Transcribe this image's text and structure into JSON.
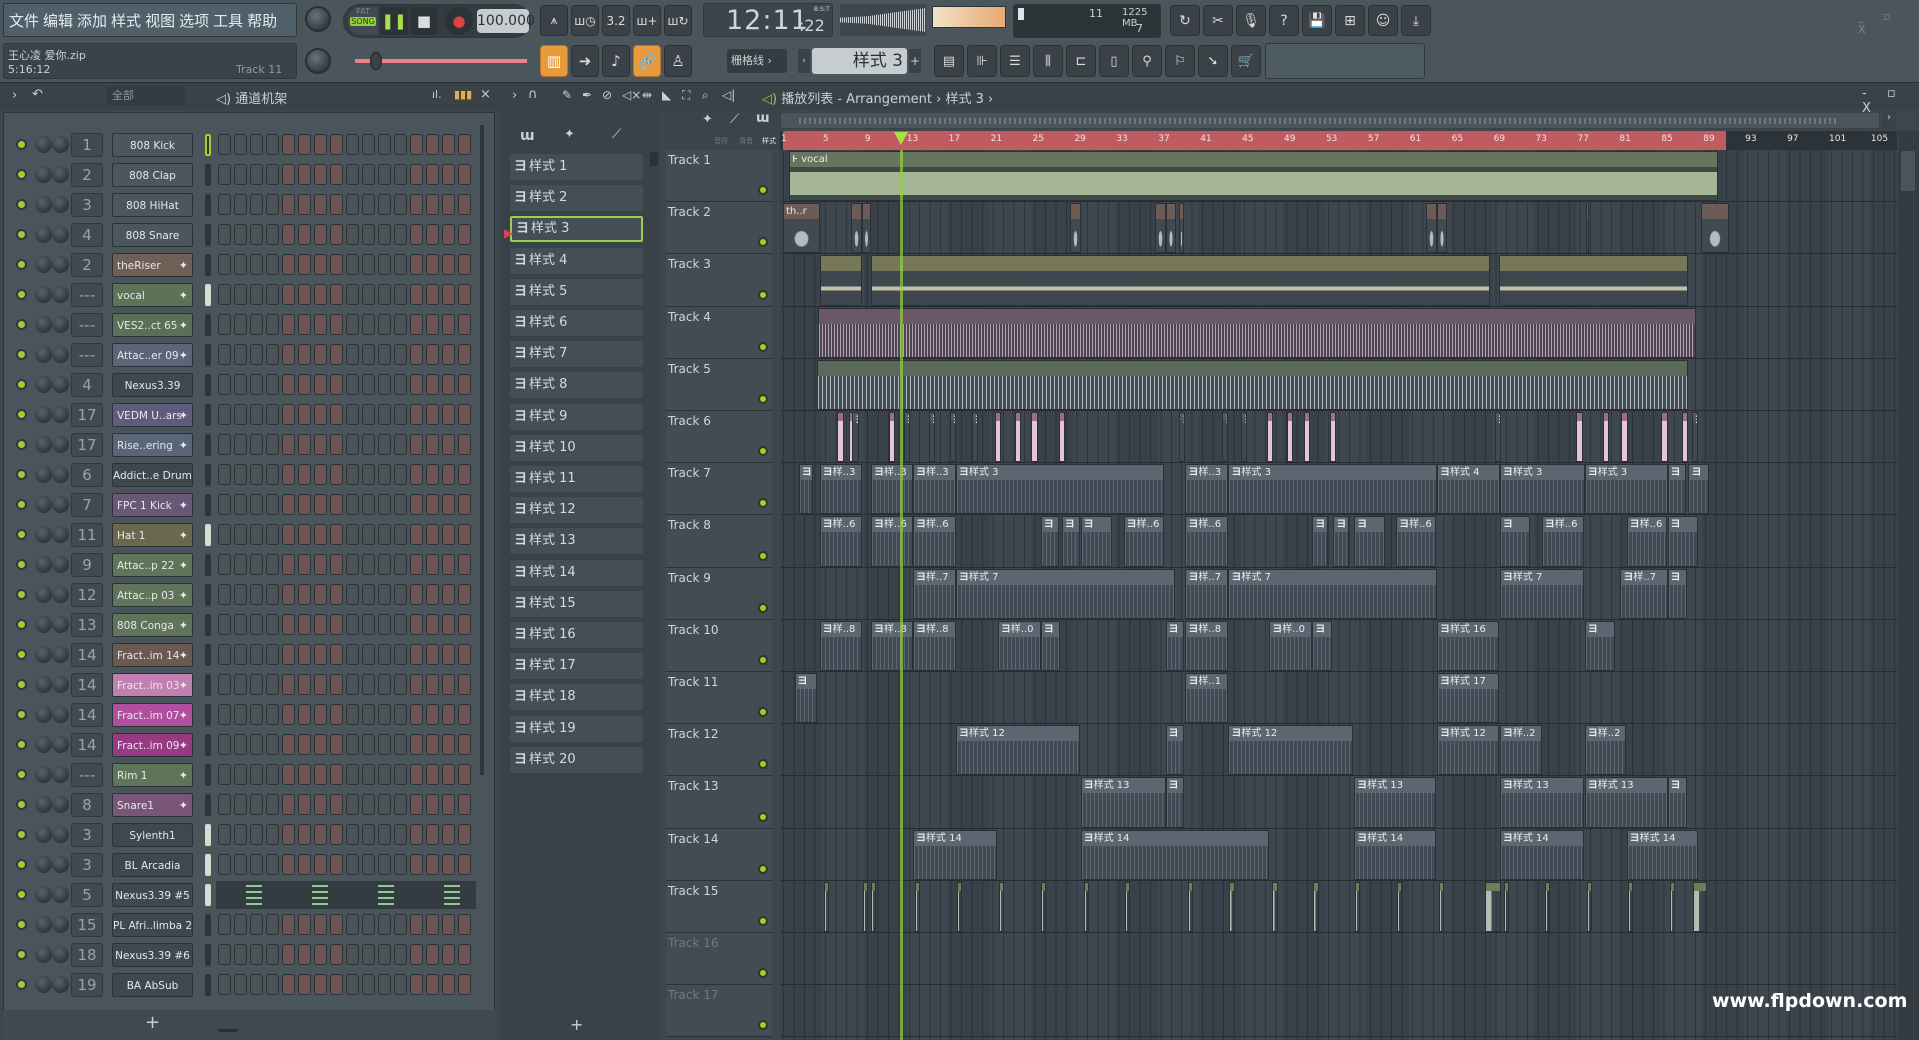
{
  "menu": [
    "文件",
    "编辑",
    "添加",
    "样式",
    "视图",
    "选项",
    "工具",
    "帮助"
  ],
  "transport": {
    "pat": "PAT",
    "song": "SONG",
    "tempo": "100.000",
    "time": "12:11",
    "time_small": ":22",
    "time_unit": "B:S:T"
  },
  "monitor": {
    "cpu": "11",
    "mem": "1225 MB",
    "poly": "7"
  },
  "hint": {
    "file": "王心凌 爱你.zip",
    "time": "5:16:12",
    "track": "Track 11"
  },
  "toolbar2": {
    "snap": "栅格线",
    "pattern": "样式 3",
    "add": "+"
  },
  "channel_rack": {
    "filter": "全部",
    "title": "通道机架",
    "add": "+",
    "channels": [
      {
        "num": "1",
        "name": "808 Kick",
        "color": "#4c565d",
        "sel": true
      },
      {
        "num": "2",
        "name": "808 Clap",
        "color": "#4c565d"
      },
      {
        "num": "3",
        "name": "808 HiHat",
        "color": "#4c565d"
      },
      {
        "num": "4",
        "name": "808 Snare",
        "color": "#4c565d"
      },
      {
        "num": "2",
        "name": "theRiser",
        "color": "#6f5f56",
        "wave": true
      },
      {
        "num": "---",
        "name": "vocal",
        "color": "#5e7258",
        "wave": true,
        "lit": true
      },
      {
        "num": "---",
        "name": "VES2..ct 65",
        "color": "#5a7057",
        "wave": true
      },
      {
        "num": "---",
        "name": "Attac..er 09",
        "color": "#5d6479",
        "wave": true
      },
      {
        "num": "4",
        "name": "Nexus3.39",
        "color": "#3f484f"
      },
      {
        "num": "17",
        "name": "VEDM U..ars",
        "color": "#615b7b",
        "wave": true
      },
      {
        "num": "17",
        "name": "Rise..ering",
        "color": "#5a6678",
        "wave": true
      },
      {
        "num": "6",
        "name": "Addict..e Drums",
        "color": "#3e474e"
      },
      {
        "num": "7",
        "name": "FPC 1 Kick",
        "color": "#6a5677",
        "wave": true
      },
      {
        "num": "11",
        "name": "Hat 1",
        "color": "#6b694d",
        "wave": true,
        "lit": true
      },
      {
        "num": "9",
        "name": "Attac..p 22",
        "color": "#5f7459",
        "wave": true
      },
      {
        "num": "12",
        "name": "Attac..p 03",
        "color": "#5f7459",
        "wave": true
      },
      {
        "num": "13",
        "name": "808 Conga",
        "color": "#5f7459",
        "wave": true
      },
      {
        "num": "14",
        "name": "Fract..im 14",
        "color": "#6b5a52",
        "wave": true
      },
      {
        "num": "14",
        "name": "Fract..im 03",
        "color": "#c27fb2",
        "wave": true
      },
      {
        "num": "14",
        "name": "Fract..im 07",
        "color": "#b04f9f",
        "wave": true
      },
      {
        "num": "14",
        "name": "Fract..im 09",
        "color": "#963a83",
        "wave": true
      },
      {
        "num": "---",
        "name": "Rim 1",
        "color": "#5e7559",
        "wave": true
      },
      {
        "num": "8",
        "name": "Snare1",
        "color": "#7a5577",
        "wave": true
      },
      {
        "num": "3",
        "name": "Sylenth1",
        "color": "#3f484f",
        "lit": true
      },
      {
        "num": "3",
        "name": "BL Arcadia",
        "color": "#3f484f",
        "lit": true
      },
      {
        "num": "5",
        "name": "Nexus3.39 #5",
        "color": "#3f484f",
        "lit": true,
        "roll": true
      },
      {
        "num": "15",
        "name": "PL Afri..limba 2",
        "color": "#3f484f"
      },
      {
        "num": "18",
        "name": "Nexus3.39 #6",
        "color": "#3f484f"
      },
      {
        "num": "19",
        "name": "BA AbSub",
        "color": "#3f484f"
      }
    ]
  },
  "playlist": {
    "title": "播放列表 - Arrangement",
    "crumb": "样式 3",
    "add": "+",
    "col_labels": [
      "音符",
      "滑音",
      "样式"
    ],
    "patterns": [
      "样式 1",
      "样式 2",
      "样式 3",
      "样式 4",
      "样式 5",
      "样式 6",
      "样式 7",
      "样式 8",
      "样式 9",
      "样式 10",
      "样式 11",
      "样式 12",
      "样式 13",
      "样式 14",
      "样式 15",
      "样式 16",
      "样式 17",
      "样式 18",
      "样式 19",
      "样式 20"
    ],
    "selected_pattern": "样式 3",
    "ruler": [
      "1",
      "5",
      "9",
      "13",
      "17",
      "21",
      "25",
      "29",
      "33",
      "37",
      "41",
      "45",
      "49",
      "53",
      "57",
      "61",
      "65",
      "69",
      "73",
      "77",
      "81",
      "85",
      "89",
      "93",
      "97",
      "101",
      "105"
    ],
    "playhead_bar": 12.2,
    "song_end_bar": 91,
    "tracks": [
      {
        "name": "Track 1",
        "type": "audio",
        "clips": [
          [
            1.6,
            90.2,
            "vocal"
          ]
        ]
      },
      {
        "name": "Track 2",
        "type": "riser",
        "clips": [
          [
            1,
            4.5,
            "th..r"
          ],
          [
            7.5,
            8.5,
            ""
          ],
          [
            8.5,
            9.4,
            ""
          ],
          [
            28.4,
            29.4,
            ""
          ],
          [
            36.5,
            37.5,
            ""
          ],
          [
            37.5,
            38.5,
            ""
          ],
          [
            38.8,
            39.3,
            ""
          ],
          [
            62.4,
            63.4,
            ""
          ],
          [
            63.4,
            64.4,
            ""
          ],
          [
            77.6,
            77.9,
            ""
          ],
          [
            88.6,
            91.3,
            ""
          ]
        ]
      },
      {
        "name": "Track 3",
        "type": "olive",
        "clips": [
          [
            4.5,
            8.5,
            ""
          ],
          [
            9.4,
            68.5,
            ""
          ],
          [
            69.3,
            87.4,
            ""
          ]
        ]
      },
      {
        "name": "Track 4",
        "type": "pink",
        "clips": [
          [
            4.3,
            88.1,
            ""
          ]
        ]
      },
      {
        "name": "Track 5",
        "type": "gray",
        "clips": [
          [
            4.2,
            87.4,
            ""
          ]
        ]
      },
      {
        "name": "Track 6",
        "type": "pinkbits",
        "clips": [
          [
            6.2,
            6.8,
            ""
          ],
          [
            7.3,
            7.9,
            ""
          ],
          [
            7.6,
            8.3,
            "ヨ"
          ],
          [
            11.1,
            11.7,
            ""
          ],
          [
            12.5,
            13.1,
            "ヨ"
          ],
          [
            14.9,
            15.5,
            "ヨ"
          ],
          [
            16.9,
            17.5,
            "ヨ"
          ],
          [
            19,
            19.6,
            "ヨ"
          ],
          [
            21.2,
            21.8,
            ""
          ],
          [
            23.1,
            23.7,
            ""
          ],
          [
            24.7,
            25.3,
            ""
          ],
          [
            27.3,
            27.9,
            ""
          ],
          [
            38.8,
            39.4,
            "ヨ"
          ],
          [
            42.9,
            43.5,
            "ヨ"
          ],
          [
            44.7,
            45.3,
            "ヨ"
          ],
          [
            47.2,
            47.8,
            ""
          ],
          [
            49.1,
            49.7,
            ""
          ],
          [
            50.7,
            51.3,
            ""
          ],
          [
            53.2,
            53.8,
            ""
          ],
          [
            68.9,
            69.5,
            "ヨ"
          ],
          [
            76.7,
            77.3,
            ""
          ],
          [
            79.2,
            79.8,
            ""
          ],
          [
            81,
            81.6,
            ""
          ],
          [
            84.8,
            85.4,
            ""
          ],
          [
            86.8,
            87.4,
            ""
          ],
          [
            87.7,
            88.3,
            "ヨ"
          ]
        ]
      },
      {
        "name": "Track 7",
        "type": "pattern",
        "clips": [
          [
            2.5,
            3.9,
            ""
          ],
          [
            4.5,
            8.5,
            "样..3"
          ],
          [
            9.4,
            13.4,
            "样..3"
          ],
          [
            13.4,
            17.5,
            "样..3"
          ],
          [
            17.5,
            37.4,
            "样式 3"
          ],
          [
            39.4,
            43.5,
            "样..3"
          ],
          [
            43.5,
            63.4,
            "样式 3"
          ],
          [
            63.4,
            69.4,
            "样式 4"
          ],
          [
            69.4,
            77.5,
            "样式 3"
          ],
          [
            77.5,
            85.4,
            "样式 3"
          ],
          [
            85.4,
            87.2,
            ""
          ],
          [
            87.4,
            89.4,
            ""
          ]
        ]
      },
      {
        "name": "Track 8",
        "type": "pattern",
        "clips": [
          [
            4.5,
            8.5,
            "样..6"
          ],
          [
            9.4,
            13.4,
            "样..6"
          ],
          [
            13.4,
            17.5,
            "样..6"
          ],
          [
            25.6,
            27.3,
            ""
          ],
          [
            27.6,
            29.3,
            ""
          ],
          [
            29.4,
            32.4,
            ""
          ],
          [
            33.5,
            37.4,
            "样..6"
          ],
          [
            39.4,
            43.5,
            "样..6"
          ],
          [
            51.5,
            53,
            ""
          ],
          [
            53.5,
            55,
            ""
          ],
          [
            55.5,
            58.4,
            ""
          ],
          [
            59.5,
            63.3,
            "样..6"
          ],
          [
            69.4,
            72.3,
            ""
          ],
          [
            73.4,
            77.4,
            "样..6"
          ],
          [
            81.5,
            85.4,
            "样..6"
          ],
          [
            85.4,
            88.3,
            ""
          ]
        ]
      },
      {
        "name": "Track 9",
        "type": "pattern",
        "clips": [
          [
            13.4,
            17.5,
            "样..7"
          ],
          [
            17.5,
            38.4,
            "样式 7"
          ],
          [
            39.4,
            43.5,
            "样..7"
          ],
          [
            43.5,
            63.4,
            "样式 7"
          ],
          [
            69.4,
            77.4,
            "样式 7"
          ],
          [
            80.9,
            85.4,
            "样..7"
          ],
          [
            85.4,
            87.3,
            ""
          ]
        ]
      },
      {
        "name": "Track 10",
        "type": "pattern",
        "clips": [
          [
            4.5,
            8.5,
            "样..8"
          ],
          [
            9.4,
            13.4,
            "样..8"
          ],
          [
            13.4,
            17.5,
            "样..8"
          ],
          [
            21.5,
            25.6,
            "样..0"
          ],
          [
            25.6,
            27.4,
            ""
          ],
          [
            37.5,
            39.3,
            ""
          ],
          [
            39.4,
            43.5,
            "样..8"
          ],
          [
            47.4,
            51.5,
            "样..0"
          ],
          [
            51.5,
            53.4,
            ""
          ],
          [
            63.4,
            69.3,
            "样式 16"
          ],
          [
            77.5,
            80.4,
            ""
          ]
        ]
      },
      {
        "name": "Track 11",
        "type": "pattern",
        "clips": [
          [
            2.1,
            4.2,
            ""
          ],
          [
            39.4,
            43.5,
            "样..1"
          ],
          [
            63.4,
            69.3,
            "样式 17"
          ]
        ]
      },
      {
        "name": "Track 12",
        "type": "pattern",
        "clips": [
          [
            17.5,
            29.3,
            "样式 12"
          ],
          [
            37.5,
            39.3,
            ""
          ],
          [
            43.5,
            55.4,
            "样式 12"
          ],
          [
            63.4,
            69.3,
            "样式 12"
          ],
          [
            69.4,
            73.4,
            "样..2"
          ],
          [
            77.5,
            81.4,
            "样..2"
          ]
        ]
      },
      {
        "name": "Track 13",
        "type": "pattern",
        "clips": [
          [
            29.4,
            37.5,
            "样式 13"
          ],
          [
            37.5,
            39.3,
            ""
          ],
          [
            55.5,
            63.3,
            "样式 13"
          ],
          [
            69.4,
            77.4,
            "样式 13"
          ],
          [
            77.5,
            85.4,
            "样式 13"
          ],
          [
            85.4,
            87.3,
            ""
          ]
        ]
      },
      {
        "name": "Track 14",
        "type": "pattern",
        "clips": [
          [
            13.4,
            21.4,
            "样式 14"
          ],
          [
            29.4,
            47.4,
            "样式 14"
          ],
          [
            55.5,
            63.3,
            "样式 14"
          ],
          [
            69.4,
            77.4,
            "样式 14"
          ],
          [
            81.5,
            88.3,
            "样式 14"
          ]
        ]
      },
      {
        "name": "Track 15",
        "type": "marks",
        "clips": [
          [
            4.9,
            5.4,
            ""
          ],
          [
            8.6,
            9.1,
            ""
          ],
          [
            9.4,
            9.9,
            ""
          ],
          [
            13.6,
            14.1,
            ""
          ],
          [
            17.6,
            18.1,
            ""
          ],
          [
            21.6,
            22.1,
            ""
          ],
          [
            25.6,
            26.1,
            ""
          ],
          [
            29.7,
            30.2,
            ""
          ],
          [
            33.6,
            34.1,
            ""
          ],
          [
            39.6,
            40.1,
            ""
          ],
          [
            43.6,
            44.1,
            ""
          ],
          [
            47.7,
            48.2,
            ""
          ],
          [
            51.6,
            52.1,
            ""
          ],
          [
            55.6,
            56.1,
            ""
          ],
          [
            59.6,
            60.1,
            ""
          ],
          [
            63.6,
            64.1,
            ""
          ],
          [
            68,
            69.5,
            ""
          ],
          [
            69.8,
            70.3,
            ""
          ],
          [
            73.7,
            74.2,
            ""
          ],
          [
            77.7,
            78.2,
            ""
          ],
          [
            81.6,
            82.1,
            ""
          ],
          [
            85.6,
            86.1,
            ""
          ],
          [
            87.8,
            89.2,
            ""
          ]
        ]
      },
      {
        "name": "Track 16",
        "type": "empty",
        "clips": []
      },
      {
        "name": "Track 17",
        "type": "empty",
        "clips": []
      }
    ]
  },
  "watermark": "www.flpdown.com",
  "colors": {
    "ruler": "#c05c60",
    "accent": "#9ccf2f",
    "orange": "#e99a3d",
    "bg": "#3d464d"
  }
}
